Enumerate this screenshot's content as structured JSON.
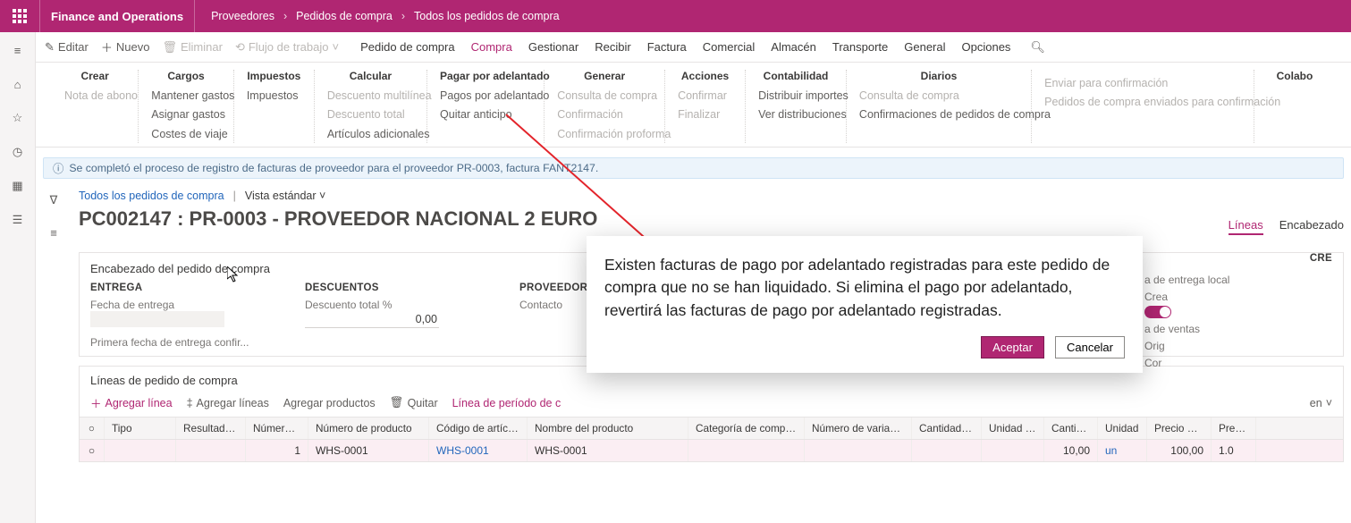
{
  "topbar": {
    "app_name": "Finance and Operations",
    "crumbs": [
      "Proveedores",
      "Pedidos de compra",
      "Todos los pedidos de compra"
    ]
  },
  "actionbar": {
    "edit": "Editar",
    "new": "Nuevo",
    "delete": "Eliminar",
    "workflow": "Flujo de trabajo",
    "tabs": [
      "Pedido de compra",
      "Compra",
      "Gestionar",
      "Recibir",
      "Factura",
      "Comercial",
      "Almacén",
      "Transporte",
      "General",
      "Opciones"
    ],
    "active_tab": "Compra"
  },
  "ribbon": {
    "crear": {
      "hdr": "Crear",
      "items": [
        "Nota de abono"
      ]
    },
    "cargos": {
      "hdr": "Cargos",
      "items": [
        "Mantener gastos",
        "Asignar gastos",
        "Costes de viaje"
      ]
    },
    "impuestos": {
      "hdr": "Impuestos",
      "items": [
        "Impuestos"
      ]
    },
    "calcular": {
      "hdr": "Calcular",
      "items": [
        "Descuento multilínea",
        "Descuento total",
        "Artículos adicionales"
      ]
    },
    "pagar": {
      "hdr": "Pagar por adelantado",
      "items": [
        "Pagos por adelantado",
        "Quitar anticipo"
      ]
    },
    "generar": {
      "hdr": "Generar",
      "items": [
        "Consulta de compra",
        "Confirmación",
        "Confirmación proforma"
      ]
    },
    "acciones": {
      "hdr": "Acciones",
      "items": [
        "Confirmar",
        "Finalizar"
      ]
    },
    "contabilidad": {
      "hdr": "Contabilidad",
      "items": [
        "Distribuir importes",
        "Ver distribuciones"
      ]
    },
    "diarios": {
      "hdr": "Diarios",
      "items": [
        "Consulta de compra",
        "Confirmaciones de pedidos de compra"
      ]
    },
    "enviar": {
      "hdr": "",
      "items": [
        "Enviar para confirmación",
        "Pedidos de compra enviados para confirmación"
      ]
    },
    "colab": {
      "hdr": "Colabo"
    }
  },
  "infobar": "Se completó el proceso de registro de facturas de proveedor para el proveedor PR-0003, factura FANT2147.",
  "breadcrumb2": {
    "link": "Todos los pedidos de compra",
    "view": "Vista estándar"
  },
  "title": "PC002147 : PR-0003 - PROVEEDOR NACIONAL 2 EURO",
  "right_tabs": {
    "lineas": "Líneas",
    "encabezado": "Encabezado"
  },
  "panel": {
    "title": "Encabezado del pedido de compra",
    "entrega": {
      "hdr": "ENTREGA",
      "fecha_lbl": "Fecha de entrega",
      "primera_lbl": "Primera fecha de entrega confir..."
    },
    "descuentos": {
      "hdr": "DESCUENTOS",
      "total_lbl": "Descuento total %",
      "total_val": "0,00"
    },
    "proveedor": {
      "hdr": "PROVEEDOR",
      "contacto_lbl": "Contacto"
    },
    "rside": {
      "entrega_lbl": "a de entrega local",
      "crea_lbl": "Crea",
      "ventas_lbl": "a de ventas",
      "orig_lbl": "Orig",
      "cor_lbl": "Cor",
      "cre_hdr": "CRE"
    }
  },
  "lines": {
    "title": "Líneas de pedido de compra",
    "toolbar": {
      "add": "Agregar línea",
      "addlines": "Agregar líneas",
      "addprod": "Agregar productos",
      "remove": "Quitar",
      "period": "Línea de período de c",
      "en": "en"
    },
    "columns": {
      "tipo": "Tipo",
      "resultados": "Resultados...",
      "numline": "Número d...",
      "numprod": "Número de producto",
      "codart": "Código de artículo",
      "nomprod": "Nombre del producto",
      "catcomp": "Categoría de compras",
      "numvar": "Número de variante",
      "cantpc": "Cantidad PC",
      "unidad": "Unidad de ...",
      "cant": "Cantidad",
      "unid": "Unidad",
      "precio": "Precio unit...",
      "preciot": "Precio..."
    },
    "row": {
      "numline": "1",
      "numprod": "WHS-0001",
      "codart": "WHS-0001",
      "nomprod": "WHS-0001",
      "cant": "10,00",
      "unid": "un",
      "precio": "100,00",
      "preciot": "1.0"
    }
  },
  "modal": {
    "text": "Existen facturas de pago por adelantado registradas para este pedido de compra que no se han liquidado. Si elimina el pago por adelantado, revertirá las facturas de pago por adelantado registradas.",
    "accept": "Aceptar",
    "cancel": "Cancelar"
  }
}
